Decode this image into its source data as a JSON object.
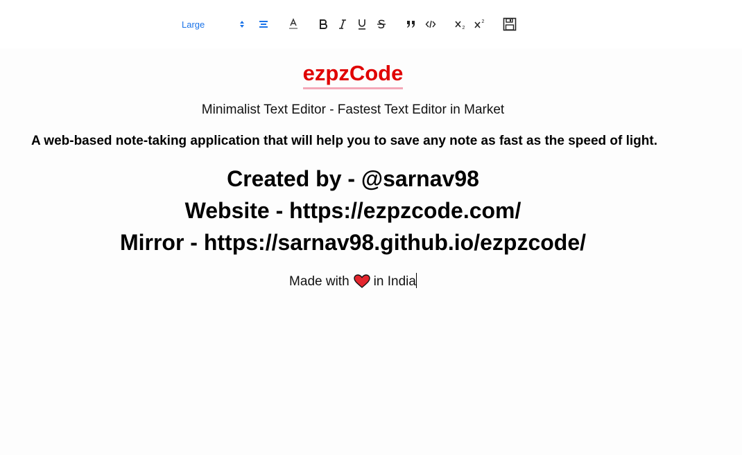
{
  "toolbar": {
    "size_value": "Large",
    "accent_color": "#1a73e8",
    "buttons": [
      "align-center-icon",
      "text-color-icon",
      "bold-icon",
      "italic-icon",
      "underline-icon",
      "strikethrough-icon",
      "blockquote-icon",
      "code-icon",
      "subscript-icon",
      "superscript-icon",
      "save-icon"
    ]
  },
  "document": {
    "title": "ezpzCode",
    "title_color": "#e00000",
    "subtitle": "Minimalist Text Editor - Fastest Text Editor in Market",
    "description": "A web-based note-taking application that will help you to save any note as fast as the speed of light.",
    "created_by": "Created by - @sarnav98",
    "website": "Website - https://ezpzcode.com/",
    "mirror": "Mirror - https://sarnav98.github.io/ezpzcode/",
    "made_with_prefix": "Made with",
    "made_with_suffix": "in India"
  }
}
